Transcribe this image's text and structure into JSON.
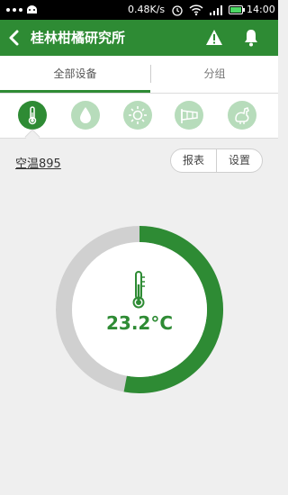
{
  "status_bar": {
    "net_speed": "0.48K/s",
    "time": "14:00",
    "icons": [
      "android-icon",
      "alarm-icon",
      "wifi-icon",
      "signal-icon",
      "battery-icon"
    ]
  },
  "header": {
    "title": "桂林柑橘研究所",
    "icons": [
      "back-arrow-icon",
      "warning-icon",
      "bell-icon"
    ]
  },
  "tabs": [
    {
      "label": "全部设备",
      "active": true
    },
    {
      "label": "分组",
      "active": false
    }
  ],
  "categories": [
    {
      "icon": "thermometer-icon",
      "active": true
    },
    {
      "icon": "humidity-drop-icon",
      "active": false
    },
    {
      "icon": "sun-light-icon",
      "active": false
    },
    {
      "icon": "windsock-icon",
      "active": false
    },
    {
      "icon": "chicken-icon",
      "active": false
    }
  ],
  "device": {
    "name": "空温895",
    "report_label": "报表",
    "settings_label": "设置"
  },
  "gauge": {
    "value": 23.2,
    "unit": "°C",
    "display": "23.2°C",
    "fill_fraction": 0.53
  },
  "colors": {
    "accent": "#2e8b34",
    "track": "#d0d0d0",
    "inactive_icon": "#b7dcbb"
  }
}
